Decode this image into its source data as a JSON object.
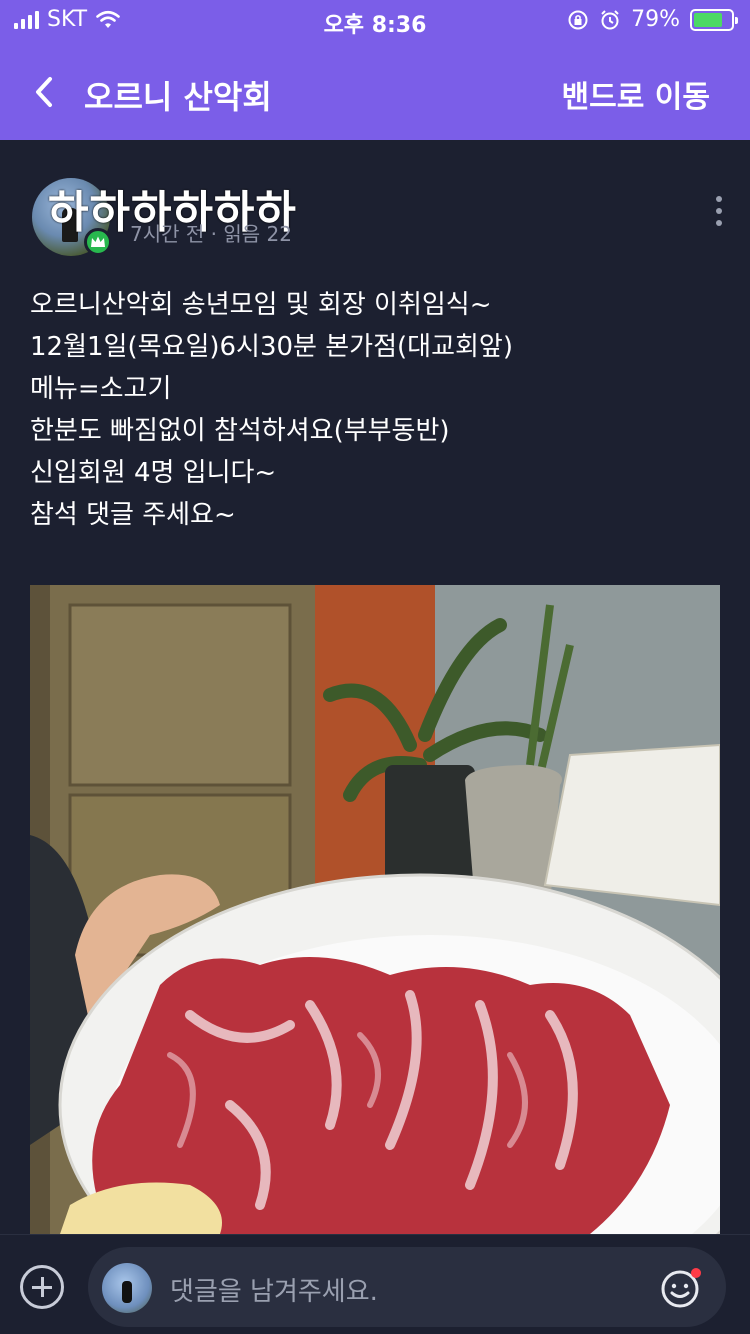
{
  "status_bar": {
    "carrier": "SKT",
    "time": "오후 8:36",
    "battery": "79%",
    "battery_level": 0.79
  },
  "header": {
    "title": "오르니 산악회",
    "action_label": "밴드로 이동"
  },
  "post": {
    "author_name": "하하하하하하",
    "meta_time": "7시간 전",
    "meta_reads": "읽음 22",
    "body_lines": [
      "오르니산악회 송년모임 및 회장 이취임식~",
      "12월1일(목요일)6시30분 본가점(대교회앞)",
      "메뉴=소고기",
      "한분도 빠짐없이 참석하셔요(부부동반)",
      "신입회원 4명 입니다~",
      "참석 댓글 주세요~"
    ]
  },
  "comment_bar": {
    "placeholder": "댓글을 남겨주세요."
  }
}
